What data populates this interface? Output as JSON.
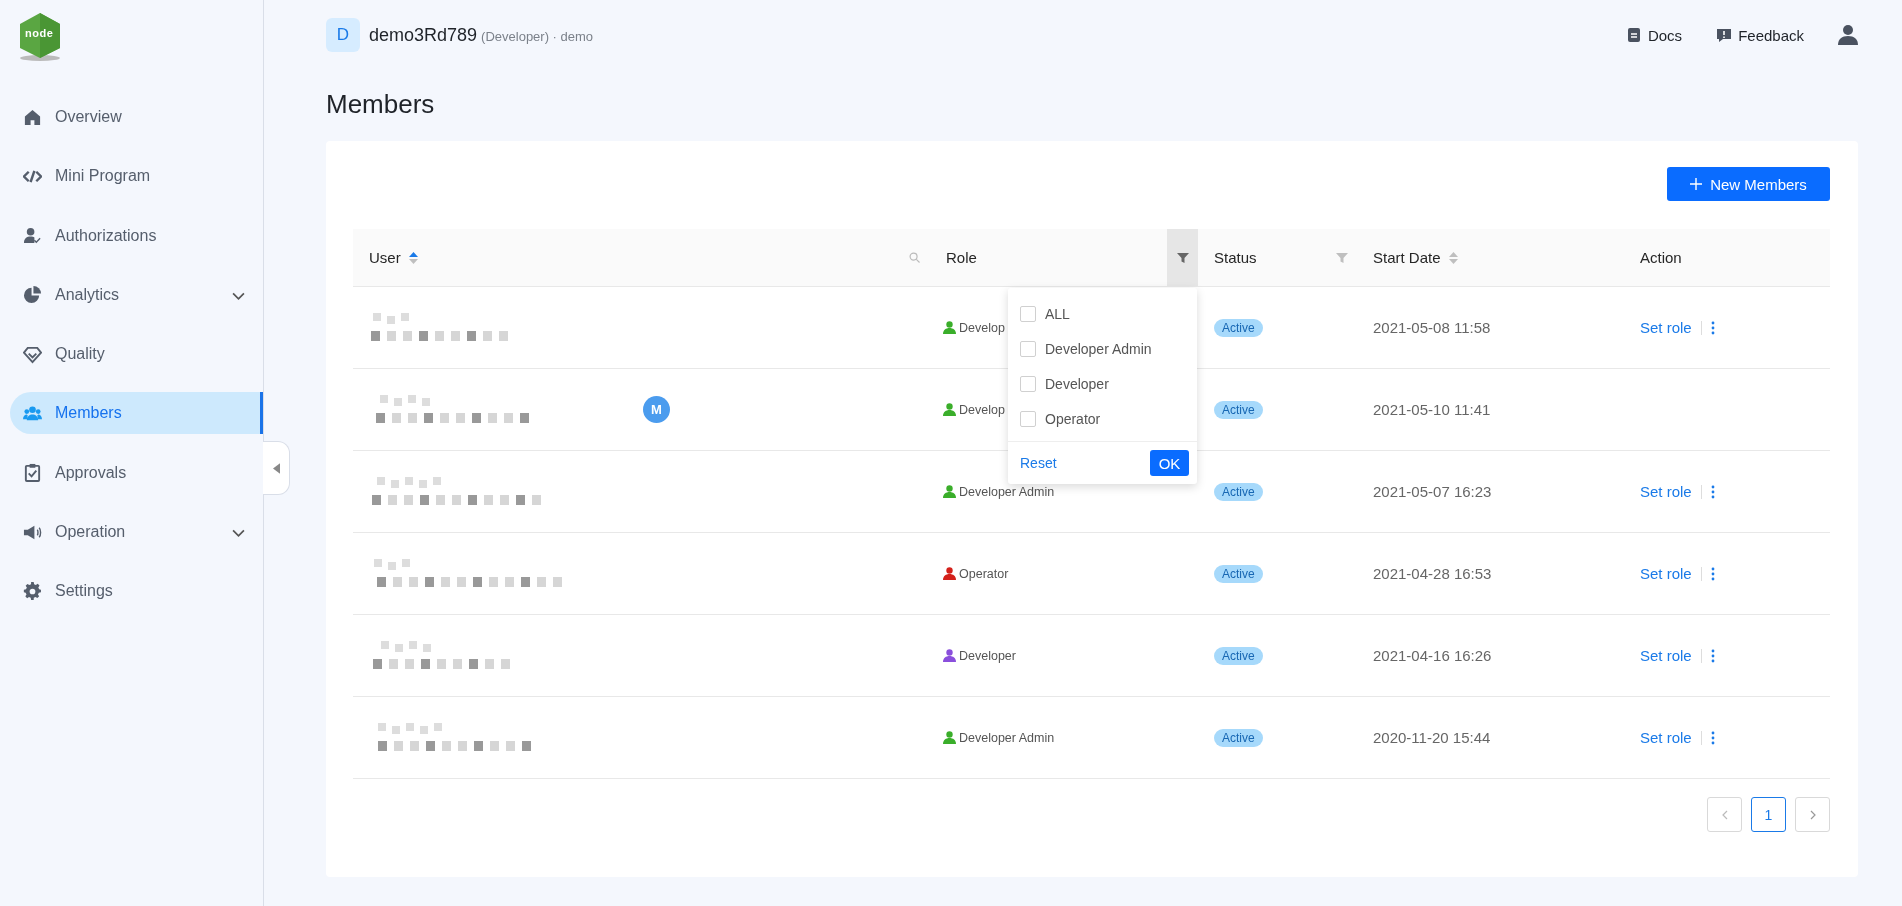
{
  "logo": {
    "text": "node"
  },
  "sidebar": {
    "items": [
      {
        "label": "Overview",
        "kind": "link",
        "selected": false
      },
      {
        "label": "Mini Program",
        "kind": "link",
        "selected": false
      },
      {
        "label": "Authorizations",
        "kind": "link",
        "selected": false
      },
      {
        "label": "Analytics",
        "kind": "submenu",
        "selected": false,
        "expanded": false
      },
      {
        "label": "Quality",
        "kind": "link",
        "selected": false
      },
      {
        "label": "Members",
        "kind": "link",
        "selected": true
      },
      {
        "label": "Approvals",
        "kind": "link",
        "selected": false
      },
      {
        "label": "Operation",
        "kind": "submenu",
        "selected": false,
        "expanded": false
      },
      {
        "label": "Settings",
        "kind": "link",
        "selected": false
      }
    ]
  },
  "header": {
    "app_initial": "D",
    "app_name": "demo3Rd789",
    "subtitle": "(Developer) · demo",
    "links": [
      {
        "label": "Docs"
      },
      {
        "label": "Feedback"
      }
    ]
  },
  "page_title": "Members",
  "new_button": "New Members",
  "table": {
    "columns": [
      {
        "label": "User",
        "sortable": true,
        "sorted_ascending": true,
        "searchable": true,
        "filterable": false
      },
      {
        "label": "Role",
        "sortable": false,
        "searchable": false,
        "filterable": true,
        "filter_open": true
      },
      {
        "label": "Status",
        "sortable": false,
        "searchable": false,
        "filterable": true,
        "filter_open": false
      },
      {
        "label": "Start Date",
        "sortable": true,
        "sorted_ascending": false,
        "searchable": false,
        "filterable": false
      },
      {
        "label": "Action",
        "sortable": false,
        "searchable": false,
        "filterable": false
      }
    ],
    "rows": [
      {
        "role": "Develop",
        "color": "#3aae2a",
        "status": "Active",
        "start_date": "2021-05-08 11:58",
        "action": "Set role",
        "more": true
      },
      {
        "avatar": "M",
        "role": "Develop",
        "color": "#3aae2a",
        "status": "Active",
        "start_date": "2021-05-10 11:41",
        "more": false
      },
      {
        "role": "Developer Admin",
        "color": "#3aae2a",
        "status": "Active",
        "start_date": "2021-05-07 16:23",
        "action": "Set role",
        "more": true
      },
      {
        "role": "Operator",
        "color": "#d4201a",
        "status": "Active",
        "start_date": "2021-04-28 16:53",
        "action": "Set role",
        "more": true
      },
      {
        "role": "Developer",
        "color": "#8a4fdc",
        "status": "Active",
        "start_date": "2021-04-16 16:26",
        "action": "Set role",
        "more": true
      },
      {
        "role": "Developer Admin",
        "color": "#3aae2a",
        "status": "Active",
        "start_date": "2020-11-20 15:44",
        "action": "Set role",
        "more": true
      }
    ]
  },
  "filter_menu": {
    "options": [
      {
        "label": "ALL",
        "checked": false
      },
      {
        "label": "Developer Admin",
        "checked": false
      },
      {
        "label": "Developer",
        "checked": false
      },
      {
        "label": "Operator",
        "checked": false
      }
    ],
    "reset": "Reset",
    "ok": "OK"
  },
  "pagination": {
    "pages": [
      {
        "label": "1",
        "selected": true
      }
    ]
  }
}
